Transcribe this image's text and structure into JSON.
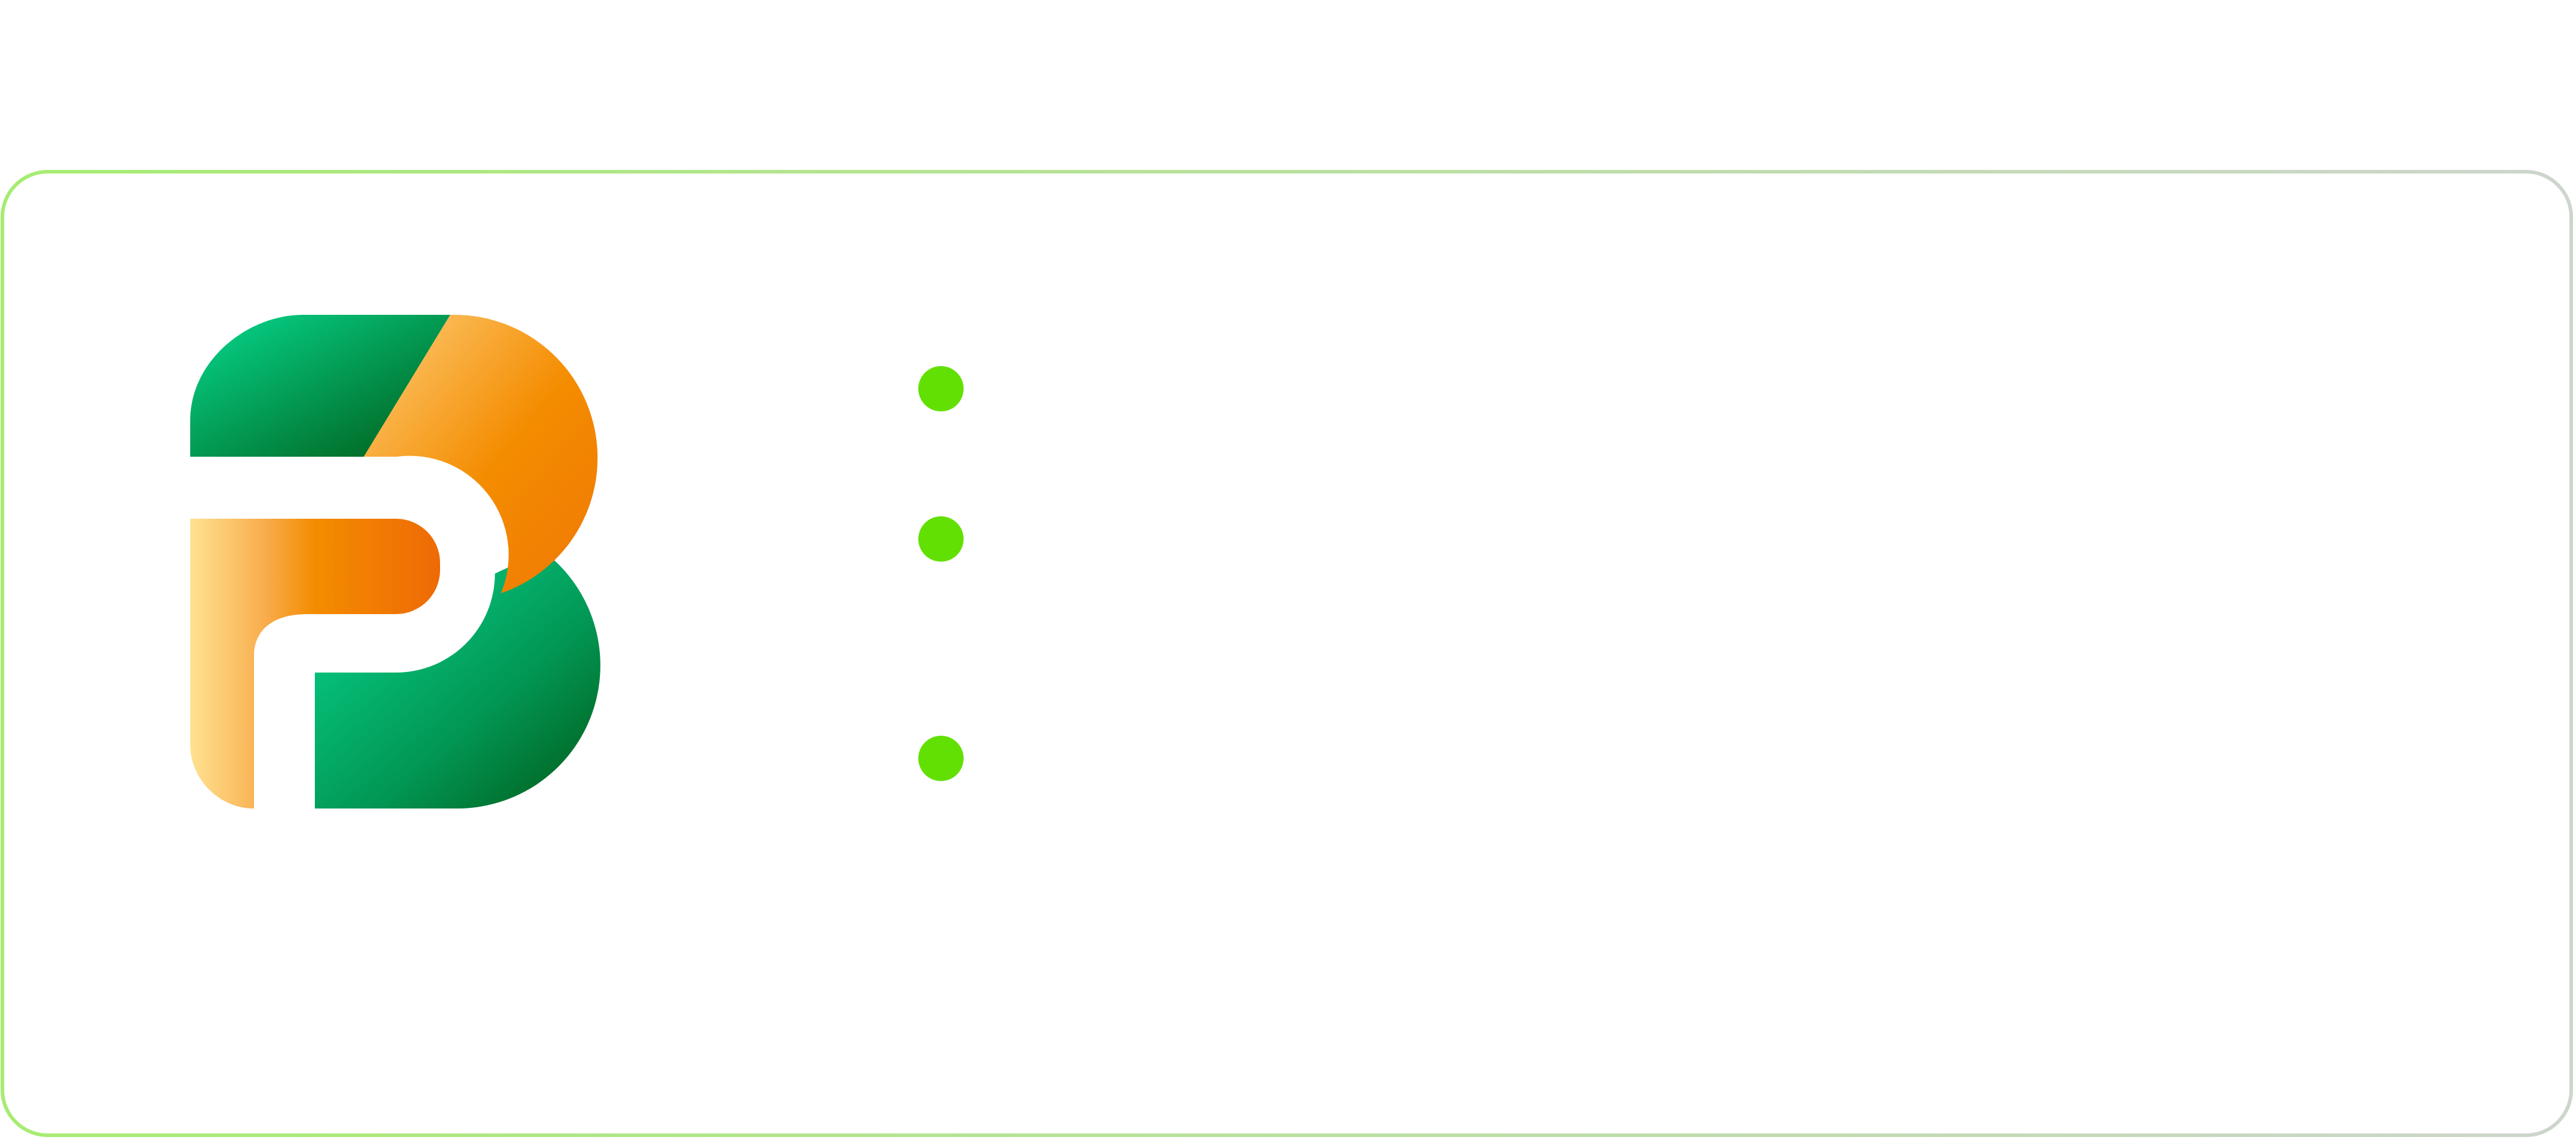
{
  "brand": {
    "logo_name": "B",
    "colors": {
      "green_light": "#06d98f",
      "green_dark": "#005a16",
      "orange_light": "#fdcd78",
      "orange_mid": "#f48c00",
      "orange_dark": "#ee6a06",
      "cream": "#ffe291"
    }
  },
  "card": {
    "border_gradient_start": "#a6ec71",
    "border_gradient_end": "#cdd5cc"
  },
  "features": {
    "bullet_color": "#62e003",
    "items": [
      {
        "icon": "bullet-dot",
        "label": ""
      },
      {
        "icon": "bullet-dot",
        "label": ""
      },
      {
        "icon": "bullet-dot",
        "label": ""
      }
    ]
  }
}
